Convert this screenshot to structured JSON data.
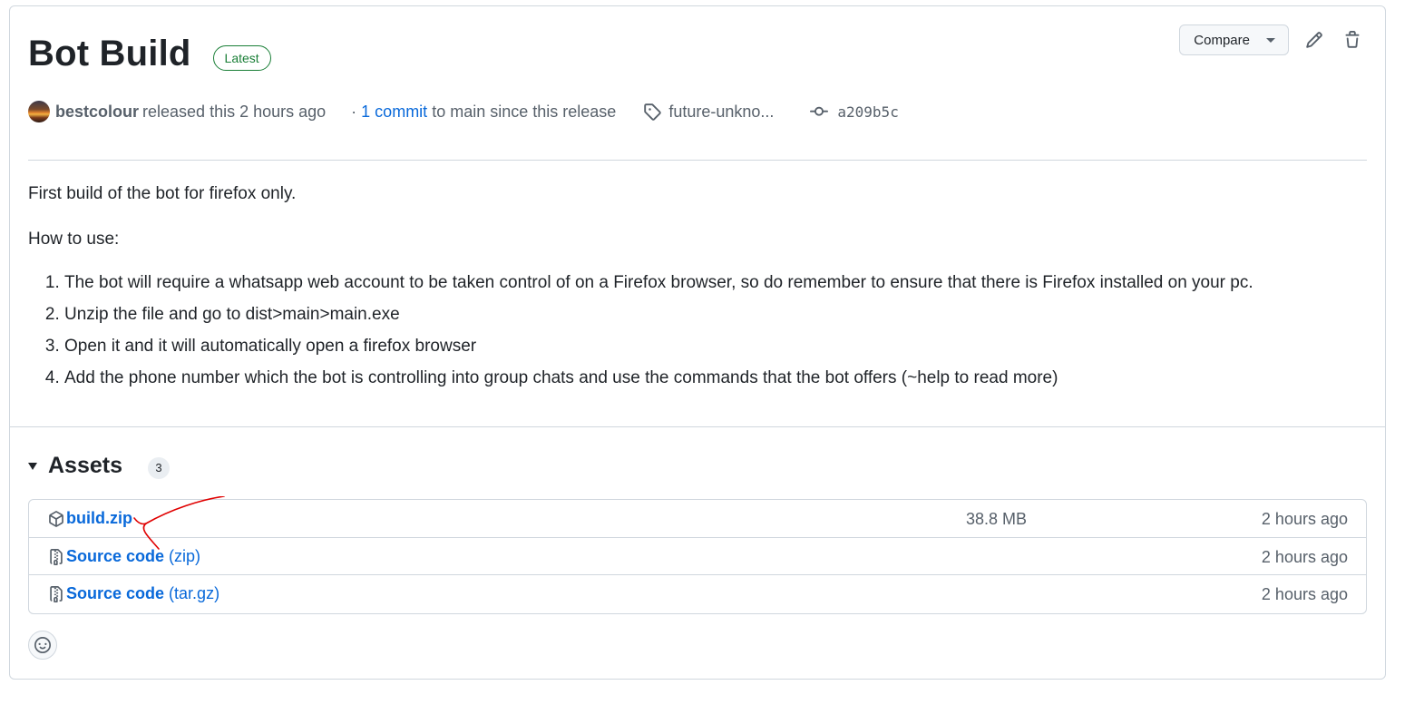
{
  "release": {
    "title": "Bot Build",
    "badge": "Latest",
    "author": "bestcolour",
    "released_text": "released this 2 hours ago",
    "commit_prefix": "·",
    "commit_link": "1 commit",
    "commit_suffix": "to main since this release",
    "tag": "future-unkno...",
    "sha": "a209b5c"
  },
  "actions": {
    "compare_label": "Compare"
  },
  "body": {
    "intro": "First build of the bot for firefox only.",
    "howto": "How to use:",
    "steps": [
      "The bot will require a whatsapp web account to be taken control of on a Firefox browser, so do remember to ensure that there is Firefox installed on your pc.",
      "Unzip the file and go to dist>main>main.exe",
      "Open it and it will automatically open a firefox browser",
      "Add the phone number which the bot is controlling into group chats and use the commands that the bot offers (~help to read more)"
    ]
  },
  "assets": {
    "title": "Assets",
    "count": "3",
    "items": [
      {
        "name": "build.zip",
        "type": "",
        "size": "38.8 MB",
        "time": "2 hours ago",
        "icon": "package-icon"
      },
      {
        "name": "Source code",
        "type": "(zip)",
        "size": "",
        "time": "2 hours ago",
        "icon": "file-zip-icon"
      },
      {
        "name": "Source code",
        "type": "(tar.gz)",
        "size": "",
        "time": "2 hours ago",
        "icon": "file-zip-icon"
      }
    ]
  },
  "colors": {
    "link": "#0969da",
    "badge_green": "#1a7f37",
    "annotation_red": "#e00000"
  }
}
